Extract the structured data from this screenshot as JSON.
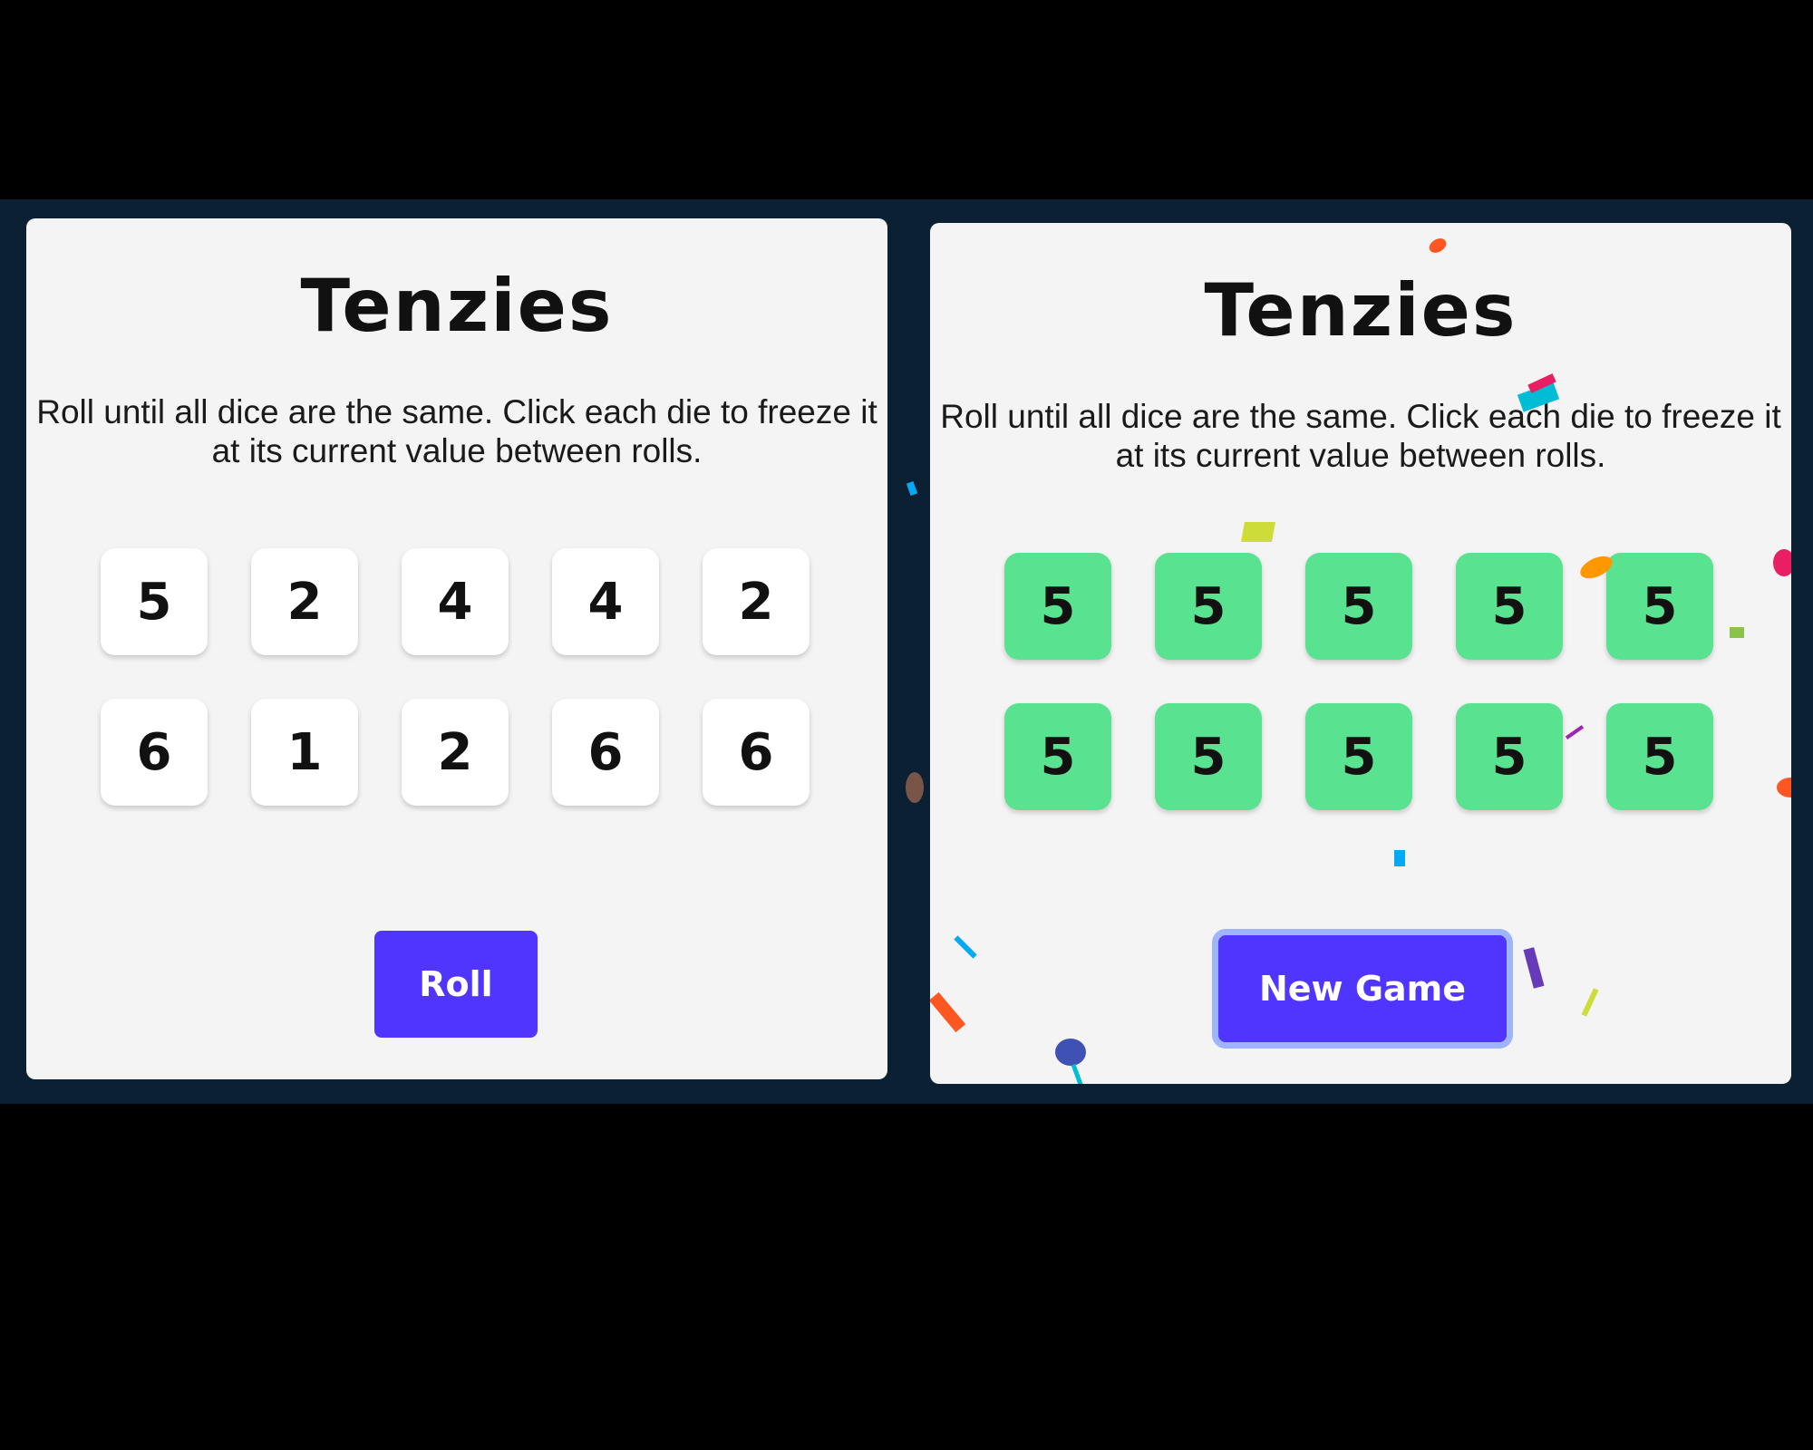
{
  "panels": [
    {
      "title": "Tenzies",
      "instructions": "Roll until all dice are the same. Click each die to freeze it at its current value between rolls.",
      "dice": [
        "5",
        "2",
        "4",
        "4",
        "2",
        "6",
        "1",
        "2",
        "6",
        "6"
      ],
      "button_label": "Roll"
    },
    {
      "title": "Tenzies",
      "instructions": "Roll until all dice are the same. Click each die to freeze it at its current value between rolls.",
      "dice": [
        "5",
        "5",
        "5",
        "5",
        "5",
        "5",
        "5",
        "5",
        "5",
        "5"
      ],
      "button_label": "New Game"
    }
  ],
  "colors": {
    "background": "#000000",
    "strip": "#0b2133",
    "card": "#f4f4f4",
    "die_free": "#ffffff",
    "die_held": "#59e391",
    "button": "#5035ff",
    "button_focus_ring": "#9fb4ff"
  }
}
